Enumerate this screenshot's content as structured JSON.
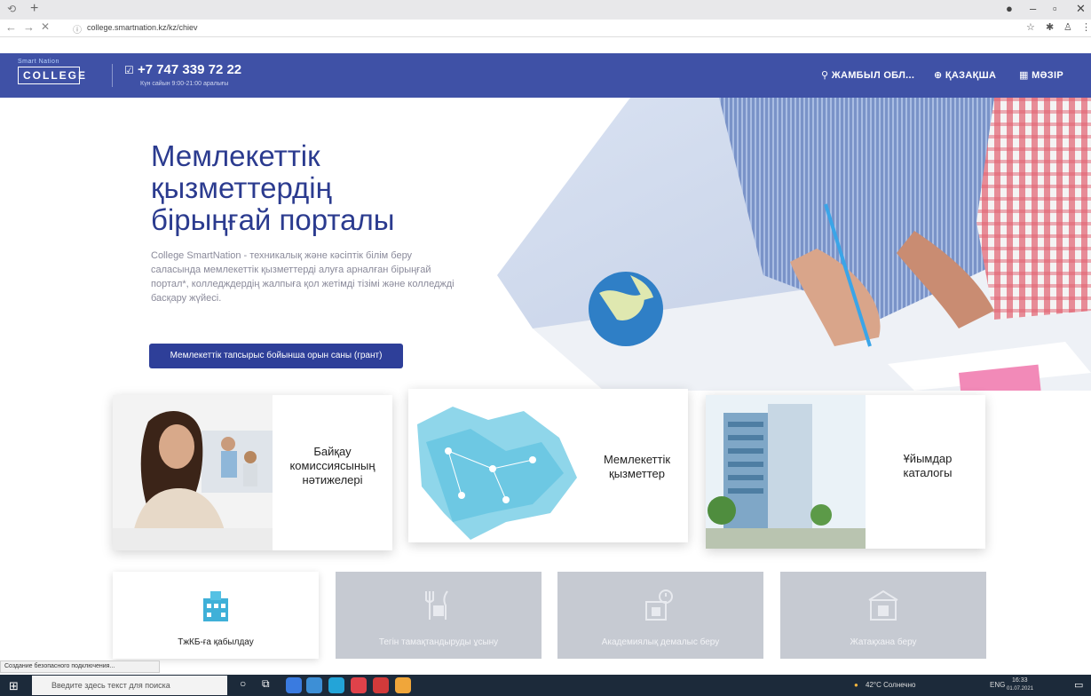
{
  "browser": {
    "url": "college.smartnation.kz/kz/chiev"
  },
  "header": {
    "logo_top": "Smart Nation",
    "logo_text": "COLLEGE",
    "phone": "+7 747 339 72 22",
    "hours": "Күн сайын 9:00-21:00 аралығы",
    "region": "ЖАМБЫЛ ОБЛ...",
    "language": "ҚАЗАҚША",
    "menu": "МӘЗІР"
  },
  "hero": {
    "title_line1": "Мемлекеттік",
    "title_line2": "қызметтердің",
    "title_line3": "бірыңғай порталы",
    "description": "College SmartNation - техникалық және кәсіптік білім беру саласында мемлекеттік қызметтерді алуға арналған бірыңғай портал*, колледждердің жалпыға қол жетімді тізімі және колледжді басқару жүйесі.",
    "grant_button": "Мемлекеттік тапсырыс бойынша орын саны (грант)"
  },
  "cards": {
    "commission_line1": "Байқау",
    "commission_line2": "комиссиясының",
    "commission_line3": "нәтижелері",
    "services_line1": "Мемлекеттік",
    "services_line2": "қызметтер",
    "catalog_line1": "Ұйымдар",
    "catalog_line2": "каталогы"
  },
  "services": [
    {
      "label": "ТжКБ-ға қабылдау",
      "active": true
    },
    {
      "label": "Тегін тамақтандыруды ұсыну",
      "active": false
    },
    {
      "label": "Академиялық демалыс беру",
      "active": false
    },
    {
      "label": "Жатақхана беру",
      "active": false
    }
  ],
  "status_bar": "Создание безопасного подключения...",
  "taskbar": {
    "search_placeholder": "Введите здесь текст для поиска",
    "weather": "42°C Солнечно",
    "lang": "ENG",
    "time": "16:33",
    "date": "01.07.2021"
  },
  "colors": {
    "header_bg": "#3f51a6",
    "title": "#2b3b8f",
    "button": "#2e3f99"
  }
}
